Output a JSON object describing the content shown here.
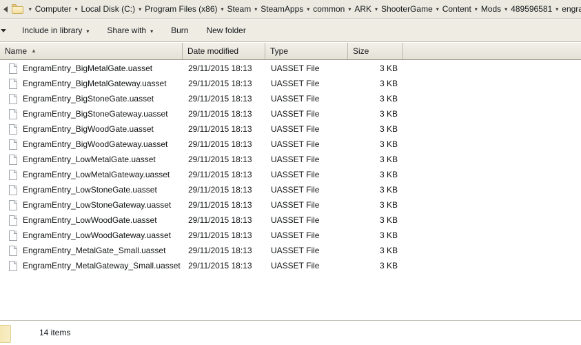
{
  "address_bar": {
    "back_icon": "chevron-left-icon",
    "folder_icon": "folder-icon",
    "separator": "▾",
    "crumbs": [
      "Computer",
      "Local Disk (C:)",
      "Program Files (x86)",
      "Steam",
      "SteamApps",
      "common",
      "ARK",
      "ShooterGame",
      "Content",
      "Mods",
      "489596581",
      "engram"
    ]
  },
  "toolbar": {
    "organize_caret": "▾",
    "items": [
      {
        "label": "Include in library",
        "caret": "▾",
        "has_caret": true
      },
      {
        "label": "Share with",
        "caret": "▾",
        "has_caret": true
      },
      {
        "label": "Burn",
        "caret": "",
        "has_caret": false
      },
      {
        "label": "New folder",
        "caret": "",
        "has_caret": false
      }
    ]
  },
  "columns": [
    {
      "label": "Name",
      "sort_arrow": "▲",
      "sorted": true
    },
    {
      "label": "Date modified",
      "sort_arrow": "",
      "sorted": false
    },
    {
      "label": "Type",
      "sort_arrow": "",
      "sorted": false
    },
    {
      "label": "Size",
      "sort_arrow": "",
      "sorted": false
    },
    {
      "label": "",
      "sort_arrow": "",
      "sorted": false
    }
  ],
  "files": [
    {
      "name": "EngramEntry_BigMetalGate.uasset",
      "date": "29/11/2015 18:13",
      "type": "UASSET File",
      "size": "3 KB"
    },
    {
      "name": "EngramEntry_BigMetalGateway.uasset",
      "date": "29/11/2015 18:13",
      "type": "UASSET File",
      "size": "3 KB"
    },
    {
      "name": "EngramEntry_BigStoneGate.uasset",
      "date": "29/11/2015 18:13",
      "type": "UASSET File",
      "size": "3 KB"
    },
    {
      "name": "EngramEntry_BigStoneGateway.uasset",
      "date": "29/11/2015 18:13",
      "type": "UASSET File",
      "size": "3 KB"
    },
    {
      "name": "EngramEntry_BigWoodGate.uasset",
      "date": "29/11/2015 18:13",
      "type": "UASSET File",
      "size": "3 KB"
    },
    {
      "name": "EngramEntry_BigWoodGateway.uasset",
      "date": "29/11/2015 18:13",
      "type": "UASSET File",
      "size": "3 KB"
    },
    {
      "name": "EngramEntry_LowMetalGate.uasset",
      "date": "29/11/2015 18:13",
      "type": "UASSET File",
      "size": "3 KB"
    },
    {
      "name": "EngramEntry_LowMetalGateway.uasset",
      "date": "29/11/2015 18:13",
      "type": "UASSET File",
      "size": "3 KB"
    },
    {
      "name": "EngramEntry_LowStoneGate.uasset",
      "date": "29/11/2015 18:13",
      "type": "UASSET File",
      "size": "3 KB"
    },
    {
      "name": "EngramEntry_LowStoneGateway.uasset",
      "date": "29/11/2015 18:13",
      "type": "UASSET File",
      "size": "3 KB"
    },
    {
      "name": "EngramEntry_LowWoodGate.uasset",
      "date": "29/11/2015 18:13",
      "type": "UASSET File",
      "size": "3 KB"
    },
    {
      "name": "EngramEntry_LowWoodGateway.uasset",
      "date": "29/11/2015 18:13",
      "type": "UASSET File",
      "size": "3 KB"
    },
    {
      "name": "EngramEntry_MetalGate_Small.uasset",
      "date": "29/11/2015 18:13",
      "type": "UASSET File",
      "size": "3 KB"
    },
    {
      "name": "EngramEntry_MetalGateway_Small.uasset",
      "date": "29/11/2015 18:13",
      "type": "UASSET File",
      "size": "3 KB"
    }
  ],
  "status_bar": {
    "folder_icon": "folder-icon",
    "item_count_label": "14 items"
  },
  "colors": {
    "chrome": "#ebe9e0",
    "toolbar": "#efece4",
    "header_top": "#f2f0e9",
    "header_bottom": "#e4e1d6",
    "list_background": "#ffffff",
    "text": "#101214",
    "folder_yellow": "#f2dea1"
  },
  "layout": {
    "col_name_width": 265,
    "col_date_width": 120,
    "col_type_width": 120,
    "col_size_width": 80,
    "col_extra_width": 258
  }
}
